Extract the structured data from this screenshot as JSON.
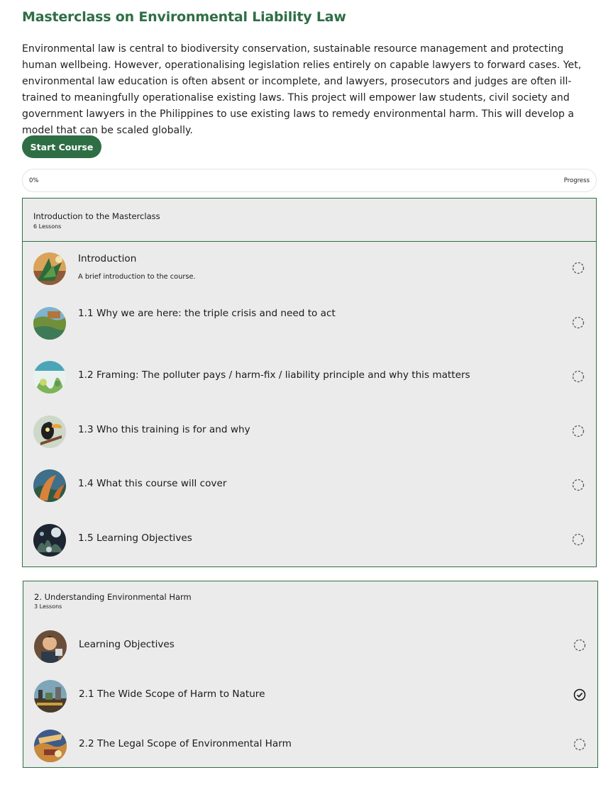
{
  "course": {
    "title": "Masterclass on Environmental Liability Law",
    "description": "Environmental law is central to biodiversity conservation, sustainable resource management and protecting human wellbeing. However, operationalising legislation relies entirely on capable lawyers to forward cases. Yet, environmental law education is often absent or incomplete, and lawyers, prosecutors and judges are often ill-trained to meaningfully operationalise existing laws. This project will empower law students, civil society and government lawyers in the Philippines to use existing laws to remedy environmental harm. This will develop a model that can be scaled globally.",
    "start_label": "Start Course"
  },
  "progress": {
    "value_label": "0%",
    "label": "Progress",
    "value": 0
  },
  "colors": {
    "accent": "#2f6e45",
    "module_bg": "#ebebeb"
  },
  "modules": [
    {
      "title": "Introduction to the Masterclass",
      "count": "6 Lessons",
      "lessons": [
        {
          "title": "Introduction",
          "subtitle": "A brief introduction to the course.",
          "status": "incomplete",
          "icon": "pending-circle-icon"
        },
        {
          "title": "1.1 Why we are here: the triple crisis and need to act",
          "status": "incomplete",
          "icon": "pending-circle-icon"
        },
        {
          "title": "1.2 Framing: The polluter pays / harm-fix / liability principle and why this matters",
          "status": "incomplete",
          "icon": "pending-circle-icon"
        },
        {
          "title": "1.3 Who this training is for and why",
          "status": "incomplete",
          "icon": "pending-circle-icon"
        },
        {
          "title": "1.4 What this course will cover",
          "status": "incomplete",
          "icon": "pending-circle-icon"
        },
        {
          "title": "1.5 Learning Objectives",
          "status": "incomplete",
          "icon": "pending-circle-icon"
        }
      ]
    },
    {
      "title": "2. Understanding Environmental Harm",
      "count": "3 Lessons",
      "lessons": [
        {
          "title": "Learning Objectives",
          "status": "incomplete",
          "icon": "pending-circle-icon"
        },
        {
          "title": "2.1 The Wide Scope of Harm to Nature",
          "status": "complete",
          "icon": "check-circle-icon"
        },
        {
          "title": "2.2 The Legal Scope of Environmental Harm",
          "status": "incomplete",
          "icon": "pending-circle-icon"
        }
      ]
    }
  ]
}
